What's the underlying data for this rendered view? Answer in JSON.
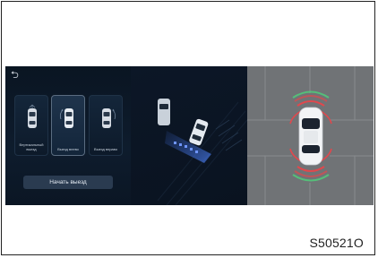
{
  "header": {
    "back_glyph": "⮌"
  },
  "modes": [
    {
      "label": "Вертикальный выезд",
      "selected": false,
      "icon": "car-top-icon"
    },
    {
      "label": "Выезд влево",
      "selected": true,
      "icon": "car-top-icon"
    },
    {
      "label": "Выезд вправо",
      "selected": false,
      "icon": "car-top-icon"
    }
  ],
  "start_button": {
    "label": "Начать выезд"
  },
  "figure_code": "S50521O",
  "colors": {
    "screen_bg": "#0b1523",
    "sensor_red": "#e0484d",
    "sensor_green": "#4fd17a",
    "path_blue": "#4a7df0"
  }
}
